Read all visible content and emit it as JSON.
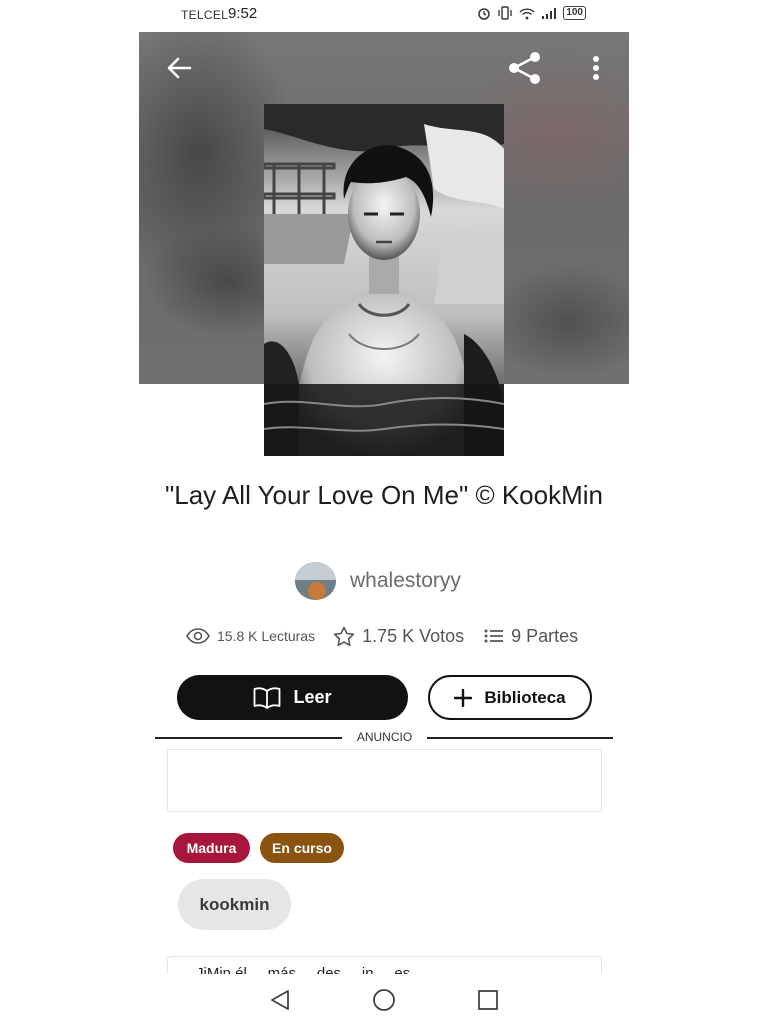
{
  "status_bar": {
    "carrier": "TELCEL",
    "time": "9:52",
    "battery": "100"
  },
  "header": {
    "back_icon": "arrow-left-icon",
    "share_icon": "share-icon",
    "more_icon": "more-vertical-icon"
  },
  "story": {
    "title": "\"Lay All Your Love On Me\" © KookMin",
    "author": "whalestoryy",
    "stats": {
      "reads": "15.8 K Lecturas",
      "votes": "1.75 K Votos",
      "parts": "9 Partes"
    }
  },
  "actions": {
    "read_label": "Leer",
    "library_label": "Biblioteca"
  },
  "ad": {
    "label": "ANUNCIO"
  },
  "badges": {
    "mature": "Madura",
    "ongoing": "En curso"
  },
  "tags": [
    "kookmin"
  ],
  "description_preview": "JiMin él ... más ... des ... in ... es ...",
  "colors": {
    "mature_badge": "#a8163b",
    "ongoing_badge": "#8a5310",
    "read_button": "#121212"
  }
}
